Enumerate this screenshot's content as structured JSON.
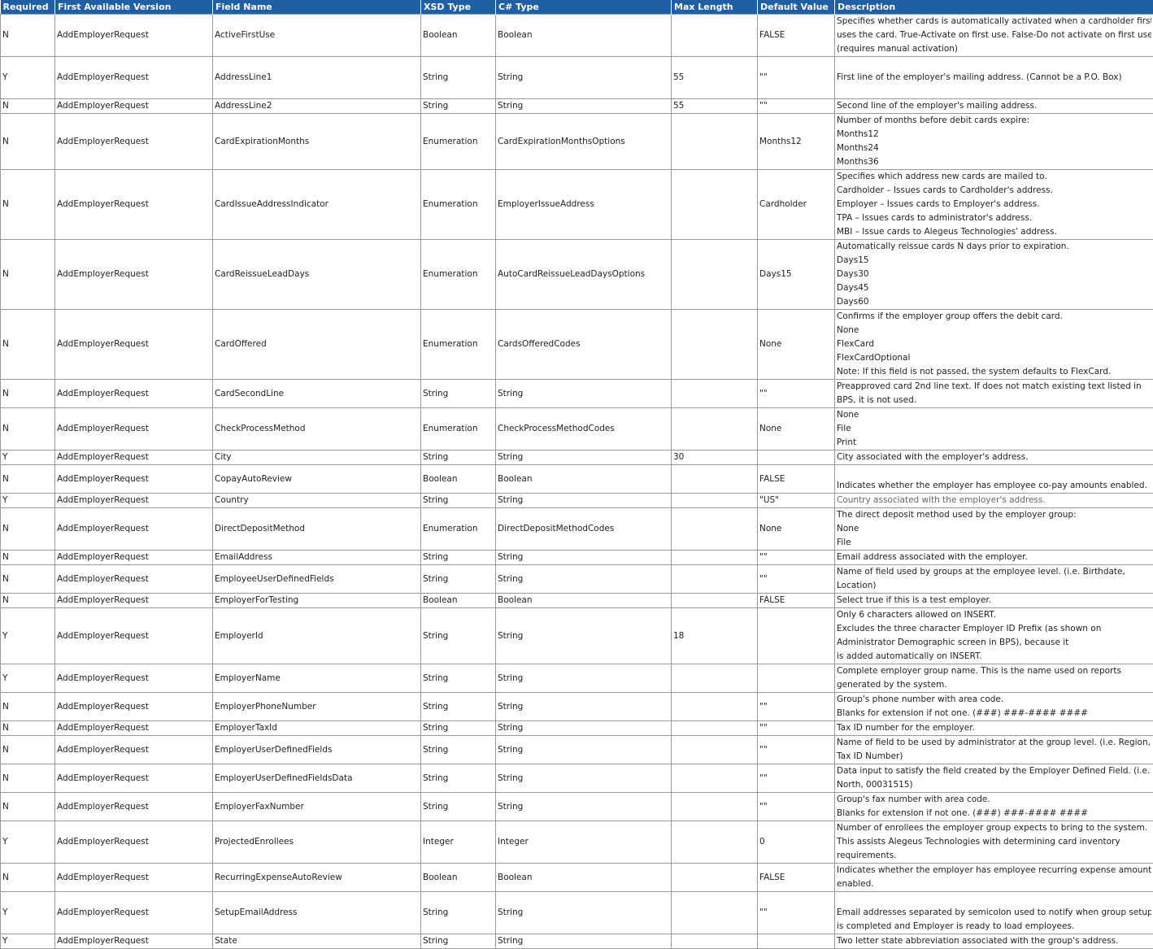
{
  "columns": [
    "Required",
    "First Available Version",
    "Field Name",
    "XSD Type",
    "C# Type",
    "Max Length",
    "Default Value",
    "Description"
  ],
  "rows": [
    {
      "required": "N",
      "version": "AddEmployerRequest",
      "field": "ActiveFirstUse",
      "xsd": "Boolean",
      "cs": "Boolean",
      "max": "",
      "default": "FALSE",
      "desc": [
        "Specifies whether cards is automatically activated when a cardholder first",
        "uses the card. True-Activate on first use. False-Do not activate on first use",
        "(requires manual activation)"
      ]
    },
    {
      "required": "Y",
      "version": "AddEmployerRequest",
      "field": "AddressLine1",
      "xsd": "String",
      "cs": "String",
      "max": "55",
      "default": "\"\"",
      "desc": [
        "",
        "First line of the employer's mailing address. (Cannot be a P.O. Box)",
        ""
      ]
    },
    {
      "required": "N",
      "version": "AddEmployerRequest",
      "field": "AddressLine2",
      "xsd": "String",
      "cs": "String",
      "max": "55",
      "default": "\"\"",
      "desc": [
        "Second line of the employer's mailing address."
      ]
    },
    {
      "required": "N",
      "version": "AddEmployerRequest",
      "field": "CardExpirationMonths",
      "xsd": "Enumeration",
      "cs": "CardExpirationMonthsOptions",
      "max": "",
      "default": "Months12",
      "desc": [
        "Number of months before debit cards expire:",
        "Months12",
        "Months24",
        "Months36"
      ]
    },
    {
      "required": "N",
      "version": "AddEmployerRequest",
      "field": "CardIssueAddressIndicator",
      "xsd": "Enumeration",
      "cs": "EmployerIssueAddress",
      "max": "",
      "default": "Cardholder",
      "desc": [
        "Specifies which address new cards are mailed to.",
        "Cardholder – Issues cards to Cardholder's address.",
        "Employer – Issues cards to Employer's address.",
        "TPA – Issues cards to administrator's address.",
        "MBI – Issue cards to Alegeus Technologies' address."
      ]
    },
    {
      "required": "N",
      "version": "AddEmployerRequest",
      "field": "CardReissueLeadDays",
      "xsd": "Enumeration",
      "cs": "AutoCardReissueLeadDaysOptions",
      "max": "",
      "default": "Days15",
      "desc": [
        "Automatically reissue cards N days prior to expiration.",
        "Days15",
        "Days30",
        "Days45",
        "Days60"
      ]
    },
    {
      "required": "N",
      "version": "AddEmployerRequest",
      "field": "CardOffered",
      "xsd": "Enumeration",
      "cs": "CardsOfferedCodes",
      "max": "",
      "default": "None",
      "desc": [
        "Confirms if the employer group offers the debit card.",
        "None",
        "FlexCard",
        "FlexCardOptional",
        "Note: If this field is not passed, the system defaults to FlexCard."
      ]
    },
    {
      "required": "N",
      "version": "AddEmployerRequest",
      "field": "CardSecondLine",
      "xsd": "String",
      "cs": "String",
      "max": "",
      "default": "\"\"",
      "desc": [
        "Preapproved card 2nd line text. If does not match existing text listed in",
        "BPS, it is not used."
      ]
    },
    {
      "required": "N",
      "version": "AddEmployerRequest",
      "field": "CheckProcessMethod",
      "xsd": "Enumeration",
      "cs": "CheckProcessMethodCodes",
      "max": "",
      "default": "None",
      "desc": [
        "None",
        "File",
        "Print"
      ]
    },
    {
      "required": "Y",
      "version": "AddEmployerRequest",
      "field": "City",
      "xsd": "String",
      "cs": "String",
      "max": "30",
      "default": "",
      "desc": [
        "City associated with the employer's address."
      ]
    },
    {
      "required": "N",
      "version": "AddEmployerRequest",
      "field": "CopayAutoReview",
      "xsd": "Boolean",
      "cs": "Boolean",
      "max": "",
      "default": "FALSE",
      "desc": [
        "",
        "Indicates whether the employer has employee co-pay amounts enabled."
      ]
    },
    {
      "required": "Y",
      "version": "AddEmployerRequest",
      "field": "Country",
      "xsd": "String",
      "cs": "String",
      "max": "",
      "default": "\"US\"",
      "desc": [
        "Country associated with the employer's address."
      ],
      "gray": true
    },
    {
      "required": "N",
      "version": "AddEmployerRequest",
      "field": "DirectDepositMethod",
      "xsd": "Enumeration",
      "cs": "DirectDepositMethodCodes",
      "max": "",
      "default": "None",
      "desc": [
        "The direct deposit method used by the employer group:",
        "None",
        "File"
      ]
    },
    {
      "required": "N",
      "version": "AddEmployerRequest",
      "field": "EmailAddress",
      "xsd": "String",
      "cs": "String",
      "max": "",
      "default": "\"\"",
      "desc": [
        "Email address associated with the employer."
      ]
    },
    {
      "required": "N",
      "version": "AddEmployerRequest",
      "field": "EmployeeUserDefinedFields",
      "xsd": "String",
      "cs": "String",
      "max": "",
      "default": "\"\"",
      "desc": [
        "Name of field used by groups at the employee level. (i.e. Birthdate,",
        "Location)"
      ]
    },
    {
      "required": "N",
      "version": "AddEmployerRequest",
      "field": "EmployerForTesting",
      "xsd": "Boolean",
      "cs": "Boolean",
      "max": "",
      "default": "FALSE",
      "desc": [
        "Select true if this is a test employer."
      ]
    },
    {
      "required": "Y",
      "version": "AddEmployerRequest",
      "field": "EmployerId",
      "xsd": "String",
      "cs": "String",
      "max": "18",
      "default": "",
      "desc": [
        "Only 6 characters allowed on INSERT.",
        "Excludes the three character Employer ID Prefix (as shown on",
        "Administrator Demographic screen in BPS), because it",
        "is added automatically on INSERT."
      ]
    },
    {
      "required": "Y",
      "version": "AddEmployerRequest",
      "field": "EmployerName",
      "xsd": "String",
      "cs": "String",
      "max": "",
      "default": "",
      "desc": [
        "Complete employer group name. This is the name used on reports",
        "generated by the system."
      ]
    },
    {
      "required": "N",
      "version": "AddEmployerRequest",
      "field": "EmployerPhoneNumber",
      "xsd": "String",
      "cs": "String",
      "max": "",
      "default": "\"\"",
      "desc": [
        "Group's phone number with area code.",
        "Blanks for extension if not one. (###) ###-#### ####"
      ]
    },
    {
      "required": "N",
      "version": "AddEmployerRequest",
      "field": "EmployerTaxId",
      "xsd": "String",
      "cs": "String",
      "max": "",
      "default": "\"\"",
      "desc": [
        "Tax ID number for the employer."
      ]
    },
    {
      "required": "N",
      "version": "AddEmployerRequest",
      "field": "EmployerUserDefinedFields",
      "xsd": "String",
      "cs": "String",
      "max": "",
      "default": "\"\"",
      "desc": [
        "Name of field to be used by administrator at the group level. (i.e. Region,",
        "Tax ID Number)"
      ]
    },
    {
      "required": "N",
      "version": "AddEmployerRequest",
      "field": "EmployerUserDefinedFieldsData",
      "xsd": "String",
      "cs": "String",
      "max": "",
      "default": "\"\"",
      "desc": [
        "Data input to satisfy the field created by the Employer Defined Field. (i.e.",
        "North, 00031515)"
      ]
    },
    {
      "required": "N",
      "version": "AddEmployerRequest",
      "field": "EmployerFaxNumber",
      "xsd": "String",
      "cs": "String",
      "max": "",
      "default": "\"\"",
      "desc": [
        "Group's fax number with area code.",
        "Blanks for extension if not one. (###) ###-#### ####"
      ]
    },
    {
      "required": "Y",
      "version": "AddEmployerRequest",
      "field": "ProjectedEnrollees",
      "xsd": "Integer",
      "cs": "Integer",
      "max": "",
      "default": "0",
      "desc": [
        "Number of enrollees the employer group expects to bring to the system.",
        "This assists Alegeus Technologies with determining card inventory",
        "requirements."
      ]
    },
    {
      "required": "N",
      "version": "AddEmployerRequest",
      "field": "RecurringExpenseAutoReview",
      "xsd": "Boolean",
      "cs": "Boolean",
      "max": "",
      "default": "FALSE",
      "desc": [
        "Indicates whether the employer has employee recurring expense amounts",
        "enabled."
      ]
    },
    {
      "required": "Y",
      "version": "AddEmployerRequest",
      "field": "SetupEmailAddress",
      "xsd": "String",
      "cs": "String",
      "max": "",
      "default": "\"\"",
      "desc": [
        "",
        "Email addresses separated by semicolon used to notify when group setup",
        "is completed and Employer is ready to load employees."
      ]
    },
    {
      "required": "Y",
      "version": "AddEmployerRequest",
      "field": "State",
      "xsd": "String",
      "cs": "String",
      "max": "",
      "default": "",
      "desc": [
        "Two letter state abbreviation associated with the group's address."
      ]
    }
  ]
}
